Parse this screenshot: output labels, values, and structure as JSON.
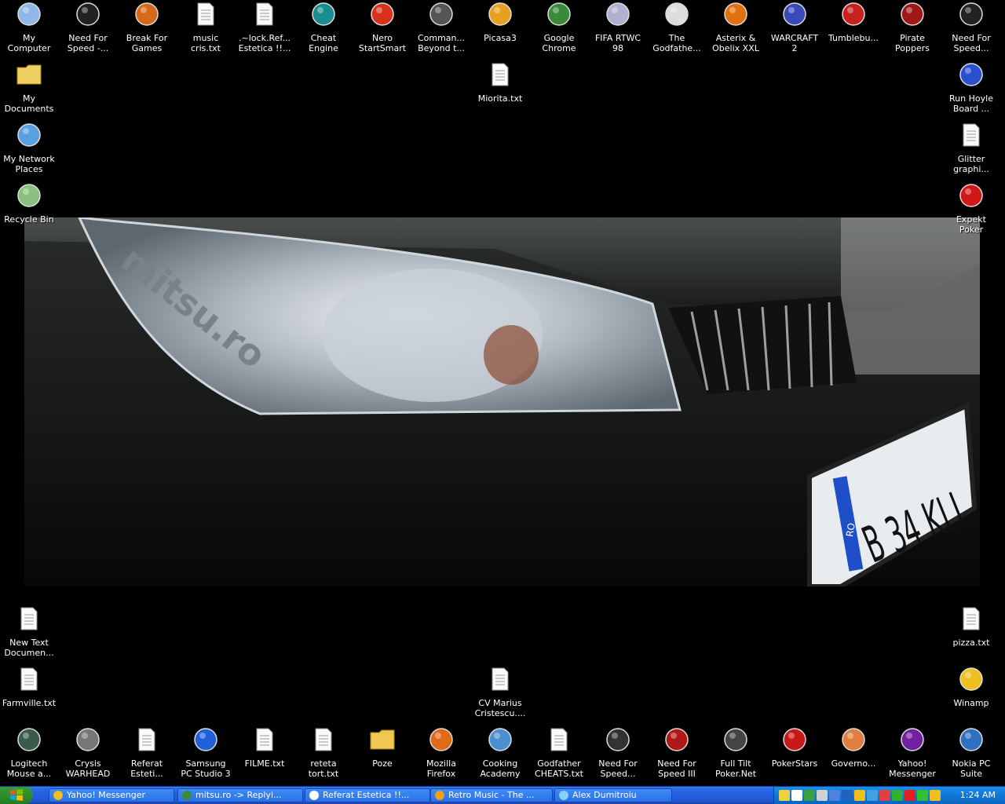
{
  "desktop_icons": [
    {
      "name": "my-computer-icon",
      "label": "My\nComputer"
    },
    {
      "name": "nfs-icon",
      "label": "Need For\nSpeed -..."
    },
    {
      "name": "break-for-games-icon",
      "label": "Break For\nGames"
    },
    {
      "name": "text-file-icon",
      "label": "music\ncris.txt"
    },
    {
      "name": "document-icon",
      "label": ".~lock.Ref...\nEstetica !!..."
    },
    {
      "name": "cheat-engine-icon",
      "label": "Cheat\nEngine"
    },
    {
      "name": "nero-icon",
      "label": "Nero\nStartSmart"
    },
    {
      "name": "grenade-icon",
      "label": "Comman...\nBeyond t..."
    },
    {
      "name": "picasa-icon",
      "label": "Picasa3"
    },
    {
      "name": "chrome-icon",
      "label": "Google\nChrome"
    },
    {
      "name": "fifa-icon",
      "label": "FIFA RTWC\n98"
    },
    {
      "name": "godfather-icon",
      "label": "The\nGodfathe..."
    },
    {
      "name": "asterix-icon",
      "label": "Asterix &\nObelix XXL"
    },
    {
      "name": "warcraft-icon",
      "label": "WARCRAFT\n2"
    },
    {
      "name": "tumblebugs-icon",
      "label": "Tumblebu..."
    },
    {
      "name": "pirate-icon",
      "label": "Pirate\nPoppers"
    },
    {
      "name": "nfs-icon",
      "label": "Need For\nSpeed..."
    },
    {
      "name": "my-documents-icon",
      "label": "My\nDocuments"
    },
    {
      "name": "text-file-icon",
      "label": "Miorita.txt"
    },
    {
      "name": "hoyle-icon",
      "label": "Run Hoyle\nBoard ..."
    },
    {
      "name": "network-places-icon",
      "label": "My Network\nPlaces"
    },
    {
      "name": "text-file-icon",
      "label": "Glitter\ngraphi..."
    },
    {
      "name": "recycle-bin-icon",
      "label": "Recycle Bin"
    },
    {
      "name": "expekt-icon",
      "label": "Expekt\nPoker"
    },
    {
      "name": "text-file-icon",
      "label": "New Text\nDocumen..."
    },
    {
      "name": "text-file-icon",
      "label": "pizza.txt"
    },
    {
      "name": "text-file-icon",
      "label": "Farmville.txt"
    },
    {
      "name": "document-icon",
      "label": "CV Marius\nCristescu...."
    },
    {
      "name": "winamp-icon",
      "label": "Winamp"
    },
    {
      "name": "logitech-icon",
      "label": "Logitech\nMouse a..."
    },
    {
      "name": "crysis-icon",
      "label": "Crysis\nWARHEAD"
    },
    {
      "name": "document-icon",
      "label": "Referat\nEsteti..."
    },
    {
      "name": "samsung-icon",
      "label": "Samsung\nPC Studio 3"
    },
    {
      "name": "text-file-icon",
      "label": "FILME.txt"
    },
    {
      "name": "text-file-icon",
      "label": "reteta\ntort.txt"
    },
    {
      "name": "folder-icon",
      "label": "Poze"
    },
    {
      "name": "firefox-icon",
      "label": "Mozilla\nFirefox"
    },
    {
      "name": "cooking-icon",
      "label": "Cooking\nAcademy"
    },
    {
      "name": "text-file-icon",
      "label": "Godfather\nCHEATS.txt"
    },
    {
      "name": "nfs-shift-icon",
      "label": "Need For\nSpeed..."
    },
    {
      "name": "nfs3-icon",
      "label": "Need For\nSpeed III"
    },
    {
      "name": "fulltilt-icon",
      "label": "Full Tilt\nPoker.Net"
    },
    {
      "name": "pokerstars-icon",
      "label": "PokerStars"
    },
    {
      "name": "governor-icon",
      "label": "Governo..."
    },
    {
      "name": "yahoo-messenger-icon",
      "label": "Yahoo!\nMessenger"
    },
    {
      "name": "nokia-icon",
      "label": "Nokia PC\nSuite"
    }
  ],
  "wallpaper": {
    "plate_text": "B 34 KLI",
    "badge_text": "RO",
    "logo_text": "mitsu.ro"
  },
  "taskbar": {
    "tasks": [
      {
        "name": "task-yahoo-messenger",
        "label": "Yahoo! Messenger",
        "icon": "yahoo-icon"
      },
      {
        "name": "task-chrome",
        "label": "mitsu.ro -> Replyi...",
        "icon": "chrome-icon"
      },
      {
        "name": "task-referat",
        "label": "Referat Estetica !!...",
        "icon": "document-icon"
      },
      {
        "name": "task-retro-music",
        "label": "Retro Music - The ...",
        "icon": "winamp-icon"
      },
      {
        "name": "task-alex",
        "label": "Alex Dumitroiu",
        "icon": "chat-icon"
      }
    ],
    "clock": "1:24 AM"
  }
}
